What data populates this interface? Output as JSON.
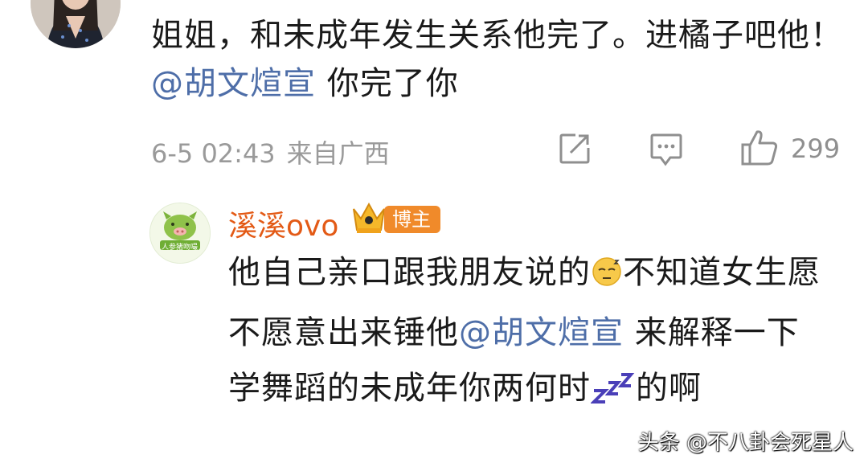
{
  "comment": {
    "text_1": "姐姐，和未成年发生关系他完了。进橘子吧他！",
    "mention": "@胡文煊宣",
    "text_2": " 你完了你",
    "time": "6-5 02:43",
    "source": "来自广西",
    "like_count": "299"
  },
  "reply": {
    "username": "溪溪ovo",
    "badge": "博主",
    "avatar_caption": "人参猪吻嘬",
    "text_1": "他自己亲口跟我朋友说的",
    "text_2": "不知道女生愿不愿意出来锤他",
    "mention": "@胡文煊宣",
    "text_3": " 来解释一下 学舞蹈的未成年你两何时",
    "text_4": "的啊"
  },
  "watermark": "头条 @不八卦会死星人",
  "icons": {
    "share": "share-icon",
    "comment": "comment-icon",
    "like": "thumbs-up-icon",
    "crown": "crown-icon",
    "emoji_1": "sleepy-face-emoji",
    "emoji_2": "zzz-emoji"
  },
  "colors": {
    "mention": "#4e6ea8",
    "username": "#e35a16",
    "badge": "#f08a2a"
  }
}
